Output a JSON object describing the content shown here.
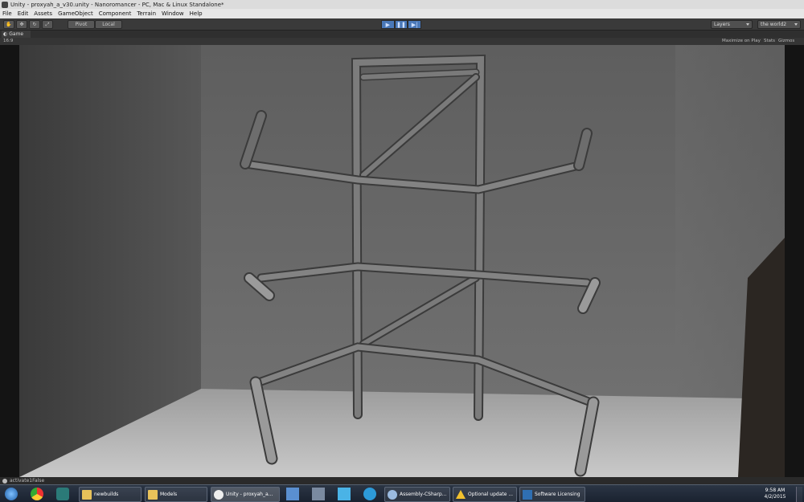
{
  "window": {
    "title": "Unity - proxyah_a_v30.unity - Nanoromancer - PC, Mac & Linux Standalone*"
  },
  "menu": {
    "items": [
      "File",
      "Edit",
      "Assets",
      "GameObject",
      "Component",
      "Terrain",
      "Window",
      "Help"
    ]
  },
  "toolbar": {
    "pivot_label": "Pivot",
    "local_label": "Local",
    "layers_label": "Layers",
    "layout_label": "the world2"
  },
  "game_tab": {
    "label": "Game",
    "aspect": "16:9",
    "maximize_label": "Maximize on Play",
    "stats_label": "Stats",
    "gizmos_label": "Gizmos"
  },
  "status": {
    "message": "activate1False"
  },
  "taskbar": {
    "items": [
      {
        "label": "newbuilds",
        "icon": "folder-icon"
      },
      {
        "label": "Models",
        "icon": "folder-icon"
      },
      {
        "label": "Unity - proxyah_a...",
        "icon": "unity-icon"
      },
      {
        "label": "Assembly-CSharp...",
        "icon": "monodevelop-icon"
      },
      {
        "label": "Optional update ...",
        "icon": "warning-icon"
      },
      {
        "label": "Software Licensing",
        "icon": "licensing-icon"
      }
    ],
    "time": "9:58 AM",
    "date": "4/2/2015"
  },
  "colors": {
    "accent": "#4a78b8",
    "toolbar": "#3a3a3a",
    "viewport_wall": "#6a6a6a",
    "floor": "#b4b4b4"
  }
}
